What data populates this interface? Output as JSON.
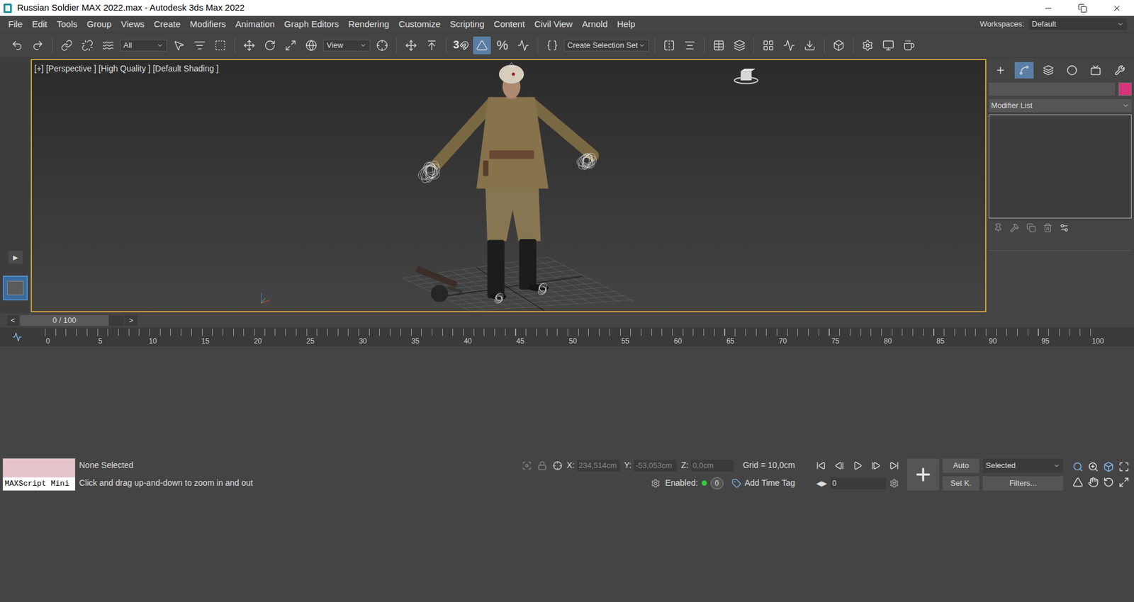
{
  "window": {
    "title": "Russian Soldier MAX 2022.max - Autodesk 3ds Max 2022"
  },
  "menu": [
    "File",
    "Edit",
    "Tools",
    "Group",
    "Views",
    "Create",
    "Modifiers",
    "Animation",
    "Graph Editors",
    "Rendering",
    "Customize",
    "Scripting",
    "Content",
    "Civil View",
    "Arnold",
    "Help"
  ],
  "workspaces": {
    "label": "Workspaces:",
    "value": "Default"
  },
  "toolbar": {
    "selection_filter": "All",
    "reference_coord": "View",
    "selection_set": "Create Selection Set",
    "snap_glyph": "3",
    "percent_glyph": "%",
    "angle_snap_selected": true
  },
  "viewport": {
    "labels": [
      "[+]",
      "[Perspective ]",
      "[High Quality ]",
      "[Default Shading ]"
    ],
    "active": true
  },
  "left_strip": {
    "expand_glyph": "▶"
  },
  "command_panel": {
    "tabs": [
      {
        "selected": false
      },
      {
        "selected": true
      },
      {
        "selected": false
      },
      {
        "selected": false
      },
      {
        "selected": false
      },
      {
        "selected": false
      }
    ],
    "name_value": "",
    "swatch_color": "#d6337a",
    "modifier_list": "Modifier List"
  },
  "time_slider": {
    "prev": "<",
    "reading": "0 / 100",
    "next": ">",
    "level": 0
  },
  "trackbar": {
    "ticks": [
      "0",
      "5",
      "10",
      "15",
      "20",
      "25",
      "30",
      "35",
      "40",
      "45",
      "50",
      "55",
      "60",
      "65",
      "70",
      "75",
      "80",
      "85",
      "90",
      "95",
      "100"
    ]
  },
  "status": {
    "maxscript": "MAXScript Mini",
    "selection": "None Selected",
    "prompt": "Click and drag up-and-down to zoom in and out",
    "coords": [
      {
        "label": "X:",
        "value": "234,514cm"
      },
      {
        "label": "Y:",
        "value": "-53,053cm"
      },
      {
        "label": "Z:",
        "value": "0,0cm"
      }
    ],
    "grid": "Grid = 10,0cm",
    "enabled": {
      "label": "Enabled:",
      "on": true,
      "value": "0"
    },
    "time_tag": "Add Time Tag",
    "auto_key": "Auto",
    "set_key": "Set K.",
    "key_filter": "Selected",
    "filters": "Filters...",
    "frame": "0"
  }
}
